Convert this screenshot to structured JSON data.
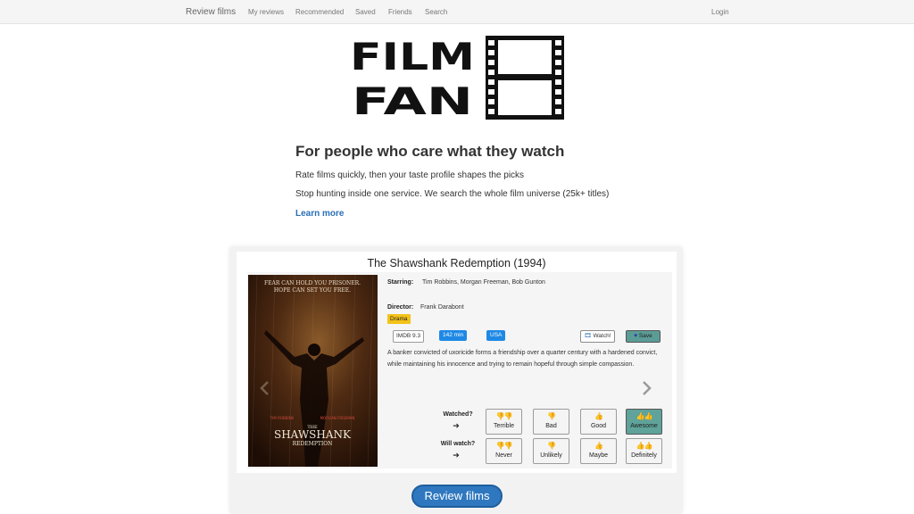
{
  "nav": {
    "brand": "Review films",
    "items": [
      "My reviews",
      "Recommended",
      "Saved",
      "Friends",
      "Search"
    ],
    "login": "Login"
  },
  "logo": {
    "line1": "FILM",
    "line2": "FAN"
  },
  "hero": {
    "title": "For people who care what they watch",
    "line1": "Rate films quickly, then your taste profile shapes the picks",
    "line2": "Stop hunting inside one service. We search the whole film universe (25k+ titles)",
    "learn_more": "Learn more"
  },
  "movie": {
    "title": "The Shawshank Redemption (1994)",
    "starring_label": "Starring:",
    "starring": "Tim Robbins, Morgan Freeman, Bob Gunton",
    "director_label": "Director:",
    "director": "Frank Darabont",
    "genre": "Drama",
    "imdb": "IMDB 9.3",
    "runtime": "142 min",
    "country": "USA",
    "watch_label": "Watch!",
    "save_label": "Save",
    "synopsis": "A banker convicted of uxoricide forms a friendship over a quarter century with a hardened convict, while maintaining his innocence and trying to remain hopeful through simple compassion.",
    "poster": {
      "tagline1": "FEAR CAN HOLD YOU PRISONER.",
      "tagline2": "HOPE CAN SET YOU FREE.",
      "actor1": "TIM ROBBINS",
      "actor2": "MORGAN FREEMAN",
      "the": "THE",
      "title1": "SHAWSHANK",
      "title2": "REDEMPTION"
    }
  },
  "ratings": {
    "watched_label": "Watched?",
    "will_watch_label": "Will watch?",
    "arrow": "➔",
    "watched": [
      {
        "label": "Terrible",
        "icon": "double-thumbs-down-icon",
        "glyph": "👎👎",
        "color": "red",
        "active": false
      },
      {
        "label": "Bad",
        "icon": "thumbs-down-icon",
        "glyph": "👎",
        "color": "red",
        "active": false
      },
      {
        "label": "Good",
        "icon": "thumbs-up-icon",
        "glyph": "👍",
        "color": "green",
        "active": false
      },
      {
        "label": "Awesome",
        "icon": "double-thumbs-up-icon",
        "glyph": "👍👍",
        "color": "green",
        "active": true
      }
    ],
    "will_watch": [
      {
        "label": "Never",
        "icon": "double-thumbs-down-icon",
        "glyph": "👎👎",
        "color": "red",
        "active": false
      },
      {
        "label": "Unlikely",
        "icon": "thumbs-down-icon",
        "glyph": "👎",
        "color": "red",
        "active": false
      },
      {
        "label": "Maybe",
        "icon": "thumbs-up-icon",
        "glyph": "👍",
        "color": "green",
        "active": false
      },
      {
        "label": "Definitely",
        "icon": "double-thumbs-up-icon",
        "glyph": "👍👍",
        "color": "green",
        "active": false
      }
    ]
  },
  "cta": {
    "label": "Review films"
  },
  "colors": {
    "accent": "#2f78c0",
    "save": "#5b9c96",
    "genre": "#f3c21a",
    "tag": "#1e88e5"
  }
}
